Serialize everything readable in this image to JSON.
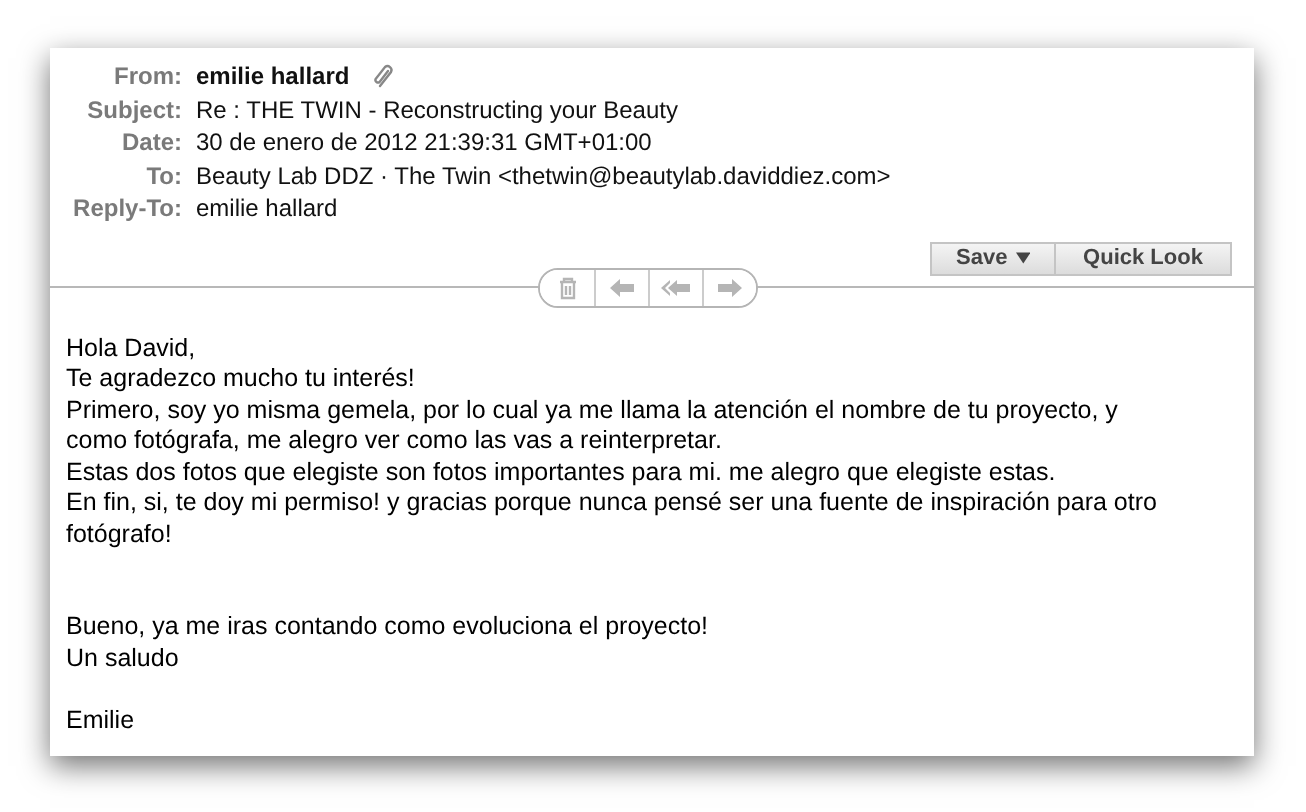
{
  "header": [
    {
      "label": "From:",
      "value": "emilie hallard",
      "bold": true,
      "attachment": true
    },
    {
      "label": "Subject:",
      "value": "Re : THE TWIN - Reconstructing your Beauty",
      "bold": false,
      "attachment": false
    },
    {
      "label": "Date:",
      "value": "30 de enero de 2012 21:39:31 GMT+01:00",
      "bold": false,
      "attachment": false
    },
    {
      "label": "To:",
      "value": "Beauty Lab DDZ · The Twin <thetwin@beautylab.daviddiez.com>",
      "bold": false,
      "attachment": false
    },
    {
      "label": "Reply-To:",
      "value": "emilie hallard",
      "bold": false,
      "attachment": false
    }
  ],
  "actions": [
    {
      "kind": "delete",
      "disabled": true
    },
    {
      "kind": "reply",
      "disabled": true
    },
    {
      "kind": "reply_all",
      "disabled": true
    },
    {
      "kind": "forward",
      "disabled": true
    }
  ],
  "buttons": [
    {
      "label": "Save",
      "menu": true
    },
    {
      "label": "Quick Look",
      "menu": false
    }
  ],
  "body": [
    [
      "Hola David,",
      "Te agradezco mucho tu interés!",
      "Primero, soy yo misma gemela, por lo cual ya me llama la atención el nombre de tu proyecto, y",
      "como fotógrafa, me alegro ver como las vas a reinterpretar.",
      "Estas dos fotos que elegiste son fotos importantes para mi. me alegro que elegiste estas.",
      "En fin, si, te doy mi permiso! y gracias porque nunca pensé ser una fuente de inspiración para otro",
      "fotógrafo!"
    ],
    [
      "Bueno, ya me iras contando como evoluciona el proyecto!",
      "Un saludo"
    ],
    [
      "Emilie"
    ]
  ]
}
